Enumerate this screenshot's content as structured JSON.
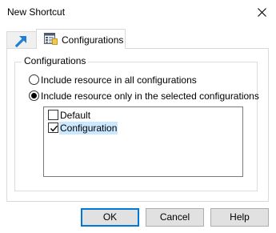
{
  "window": {
    "title": "New Shortcut"
  },
  "tabs": [
    {
      "label": "",
      "icon": "shortcut-arrow-icon"
    },
    {
      "label": "Configurations",
      "icon": "configurations-icon",
      "selected": true
    }
  ],
  "group": {
    "label": "Configurations",
    "options": [
      {
        "label": "Include resource in all configurations",
        "checked": false
      },
      {
        "label": "Include resource only in the selected configurations",
        "checked": true
      }
    ],
    "configurations": [
      {
        "label": "Default",
        "checked": false,
        "selected": false
      },
      {
        "label": "Configuration",
        "checked": true,
        "selected": true
      }
    ]
  },
  "buttons": {
    "ok": "OK",
    "cancel": "Cancel",
    "help": "Help"
  },
  "colors": {
    "accent": "#0078d7",
    "selection": "#cce8ff",
    "button_face": "#e1e1e1"
  }
}
